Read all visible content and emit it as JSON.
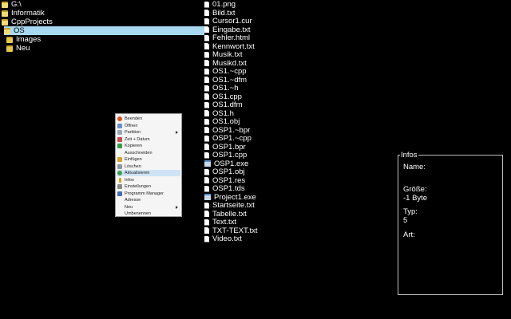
{
  "tree": {
    "items": [
      {
        "label": "G:\\",
        "open": true
      },
      {
        "label": "Informatik",
        "open": true
      },
      {
        "label": "CppProjects",
        "open": true
      },
      {
        "label": "OS",
        "open": true,
        "selected": true
      },
      {
        "label": "Images",
        "open": false
      },
      {
        "label": "Neu",
        "open": false
      }
    ]
  },
  "files": {
    "items": [
      "01.png",
      "Bild.txt",
      "Cursor1.cur",
      "Eingabe.txt",
      "Fehler.html",
      "Kennwort.txt",
      "Musik.txt",
      "Musikd.txt",
      "OS1.~cpp",
      "OS1.~dfm",
      "OS1.~h",
      "OS1.cpp",
      "OS1.dfm",
      "OS1.h",
      "OS1.obj",
      "OSP1.~bpr",
      "OSP1.~cpp",
      "OSP1.bpr",
      "OSP1.cpp",
      "OSP1.exe",
      "OSP1.obj",
      "OSP1.res",
      "OSP1.tds",
      "Project1.exe",
      "Startseite.txt",
      "Tabelle.txt",
      "Text.txt",
      "TXT-TEXT.txt",
      "Video.txt"
    ]
  },
  "context_menu": {
    "items": [
      {
        "label": "Beenden",
        "icon": "power-icon",
        "color": "#d9531e"
      },
      {
        "label": "Öffnen",
        "icon": "open-icon",
        "color": "#6a8fc8"
      },
      {
        "label": "Partition",
        "icon": "drive-icon",
        "color": "#9aa7b8",
        "submenu": true
      },
      {
        "label": "Zeit + Datum",
        "icon": "calendar-icon",
        "color": "#c84b4b"
      },
      {
        "label": "Kopieren",
        "icon": "copy-icon",
        "color": "#3a9a4a"
      },
      {
        "label": "Ausschneiden",
        "icon": "cut-icon",
        "color": ""
      },
      {
        "label": "Einfügen",
        "icon": "paste-icon",
        "color": "#d8a030"
      },
      {
        "label": "Löschen",
        "icon": "delete-icon",
        "color": "#8a94a8"
      },
      {
        "label": "Aktualisieren",
        "icon": "refresh-icon",
        "color": "#3aa04a",
        "highlight": true
      },
      {
        "label": "Infos",
        "icon": "info-icon",
        "color": "#d8a020"
      },
      {
        "label": "Einstellungen",
        "icon": "settings-icon",
        "color": "#8a8a8a"
      },
      {
        "label": "Programm Manager",
        "icon": "program-manager-icon",
        "color": "#4a6ab8"
      },
      {
        "label": "Adresse",
        "icon": "",
        "color": ""
      },
      {
        "label": "Neu",
        "icon": "",
        "color": "",
        "submenu": true
      },
      {
        "label": "Umbenennen",
        "icon": "",
        "color": ""
      }
    ]
  },
  "info_panel": {
    "title": "Infos",
    "name_label": "Name:",
    "name_value": "",
    "size_label": "Größe:",
    "size_value": "-1  Byte",
    "type_label": "Typ:",
    "type_value": "5",
    "kind_label": "Art:",
    "kind_value": ""
  },
  "colors": {
    "background": "#000000",
    "selection": "#a8d8f0",
    "menu_background": "#f5f5f5",
    "menu_highlight": "#cfe3f5",
    "folder": "#e8c84a"
  }
}
